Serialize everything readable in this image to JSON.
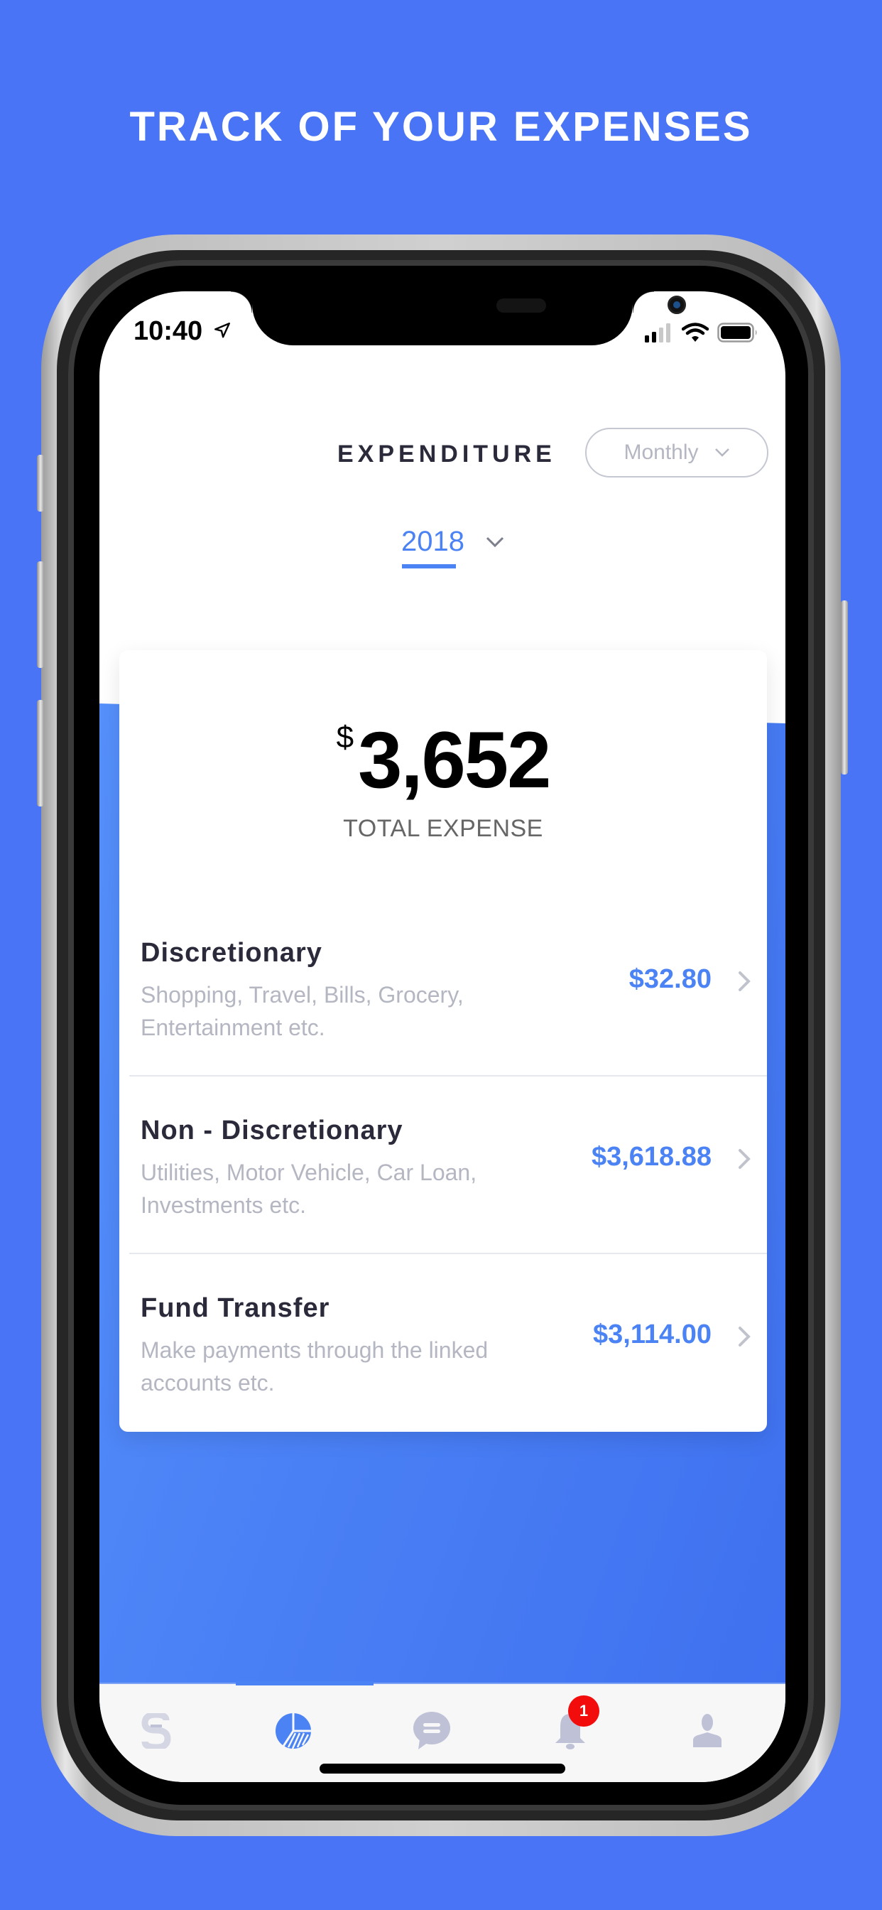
{
  "headline": "TRACK OF YOUR EXPENSES",
  "status_bar": {
    "time": "10:40",
    "location_icon": "location-arrow-icon",
    "signal_icon": "cellular-signal-icon",
    "wifi_icon": "wifi-icon",
    "battery_icon": "battery-icon"
  },
  "header": {
    "title": "EXPENDITURE",
    "period_select": {
      "selected": "Monthly",
      "icon": "chevron-down-icon"
    },
    "year_select": {
      "selected": "2018",
      "icon": "chevron-down-icon"
    }
  },
  "summary": {
    "currency": "$",
    "total": "3,652",
    "label": "TOTAL EXPENSE"
  },
  "categories": [
    {
      "title": "Discretionary",
      "description": "Shopping, Travel, Bills, Grocery, Entertainment etc.",
      "amount": "$32.80"
    },
    {
      "title": "Non - Discretionary",
      "description": "Utilities, Motor Vehicle, Car Loan, Investments etc.",
      "amount": "$3,618.88"
    },
    {
      "title": "Fund Transfer",
      "description": "Make payments through the linked accounts etc.",
      "amount": "$3,114.00"
    }
  ],
  "tabbar": {
    "active_index": 1,
    "tabs": [
      {
        "name": "transfer",
        "icon": "dollar-exchange-icon"
      },
      {
        "name": "expenditure",
        "icon": "pie-chart-icon"
      },
      {
        "name": "messages",
        "icon": "chat-bubble-icon"
      },
      {
        "name": "notifications",
        "icon": "bell-icon",
        "badge": "1"
      },
      {
        "name": "profile",
        "icon": "user-icon"
      }
    ]
  },
  "colors": {
    "background": "#4874f5",
    "accent": "#4b83f4",
    "badge": "#f30c0c",
    "muted_text": "#b4b6c2",
    "dark_text": "#2a2a3a",
    "inactive_icon": "#bfc2d6"
  }
}
